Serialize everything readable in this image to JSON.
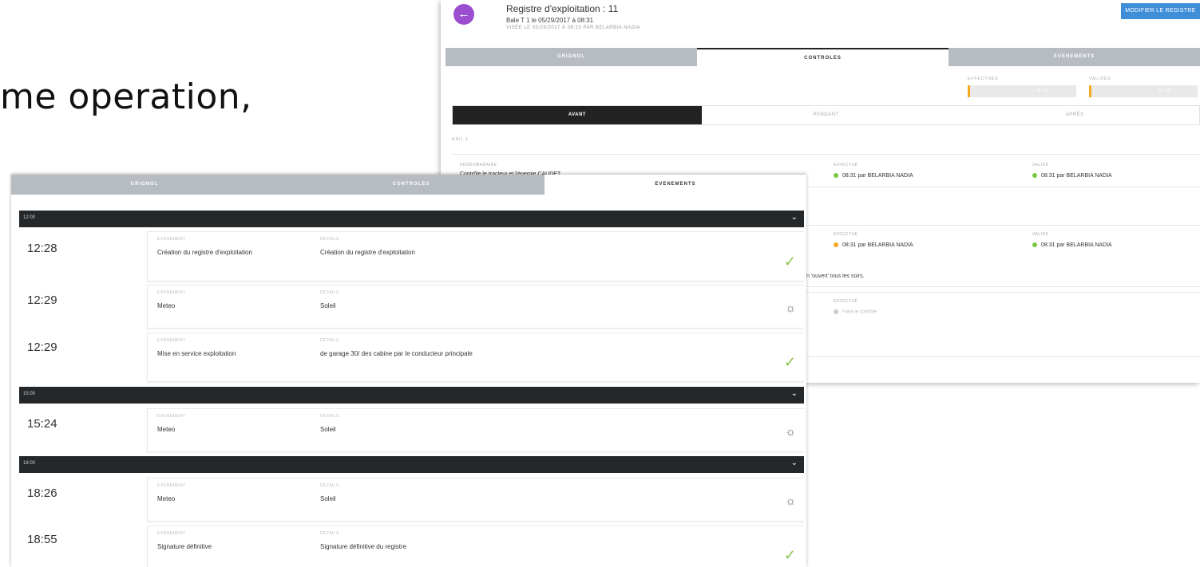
{
  "slide": {
    "text": "me operation,"
  },
  "back": {
    "back_icon": "←",
    "title": "Registre d'exploitation : 11",
    "subtitle": "Bale T 1 le 05/29/2017 à 08:31",
    "signed": "VISÉE LE 05/29/2017 À 08:33 PAR BELARBIA NADIA",
    "modify_button": "MODIFIER LE REGISTRE",
    "tabs": [
      "GRIGNOL",
      "CONTROLES",
      "EVENEMENTS"
    ],
    "stats": [
      {
        "label": "EFFECTUÉS",
        "value": "4 / 12"
      },
      {
        "label": "VALIDÉS",
        "value": "4 / 12"
      }
    ],
    "phases": [
      "AVANT",
      "PENDANT",
      "APRÈS"
    ],
    "rail_label": "RAIL 1",
    "card1": {
      "label": "HEBDOMADAIRE",
      "text": "Contrôle le tracteur et l'énergie CAUDET",
      "effectue_label": "EFFECTUÉ",
      "effectue": "08:31 par BELARBIA NADIA",
      "valide_label": "VALIDÉ",
      "valide": "08:31 par BELARBIA NADIA"
    },
    "card2": {
      "effectue_label": "EFFECTUÉ",
      "effectue": "08:31 par BELARBIA NADIA",
      "valide_label": "VALIDÉ",
      "valide": "08:31 par BELARBIA NADIA",
      "note": "n 'ouvert' tous les soirs."
    },
    "card3": {
      "effectue_label": "EFFECTUÉ",
      "effectue": "Faire le contrôle"
    },
    "colors": {
      "green": "#7ac943",
      "orange": "#f5a623",
      "grey": "#cccccc"
    }
  },
  "front": {
    "tabs": [
      "GRIGNOL",
      "CONTROLES",
      "EVENEMENTS"
    ],
    "groups": [
      {
        "label": "12:00",
        "rows": [
          {
            "time": "12:28",
            "event_label": "EVENEMENT",
            "event": "Création du registre d'exploitation",
            "details_label": "DETAILS",
            "details": "Création du registre d'exploitation",
            "icon": "check-icon"
          },
          {
            "time": "12:29",
            "event_label": "EVENEMENT",
            "event": "Meteo",
            "details_label": "DETAILS",
            "details": "Soleil",
            "icon": "sun-icon"
          },
          {
            "time": "12:29",
            "event_label": "EVENEMENT",
            "event": "Mise en service exploitation",
            "details_label": "DETAILS",
            "details": "de garage 30/ des cabine par le conducteur principale",
            "icon": "check-icon"
          }
        ]
      },
      {
        "label": "15:00",
        "rows": [
          {
            "time": "15:24",
            "event_label": "EVENEMENT",
            "event": "Meteo",
            "details_label": "DETAILS",
            "details": "Soleil",
            "icon": "sun-icon"
          }
        ]
      },
      {
        "label": "18:00",
        "rows": [
          {
            "time": "18:26",
            "event_label": "EVENEMENT",
            "event": "Meteo",
            "details_label": "DETAILS",
            "details": "Soleil",
            "icon": "sun-icon"
          },
          {
            "time": "18:55",
            "event_label": "EVENEMENT",
            "event": "Signature définitive",
            "details_label": "DETAILS",
            "details": "Signature définitive du registre",
            "icon": "check-icon"
          }
        ]
      }
    ],
    "icons": {
      "check": "✓",
      "sun": "☼",
      "chevron": "⌄"
    }
  }
}
